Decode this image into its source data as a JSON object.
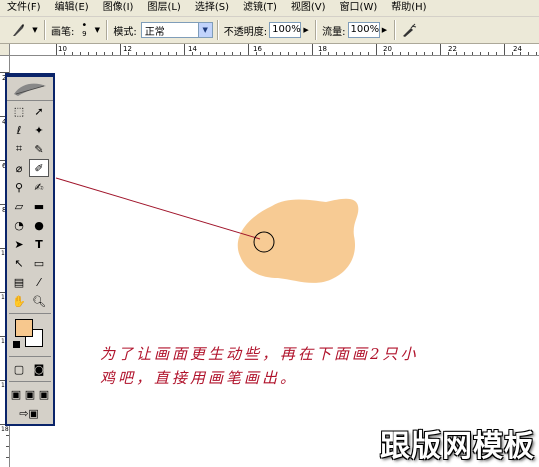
{
  "menu": [
    "文件(F)",
    "编辑(E)",
    "图像(I)",
    "图层(L)",
    "选择(S)",
    "滤镜(T)",
    "视图(V)",
    "窗口(W)",
    "帮助(H)"
  ],
  "options": {
    "brush_label": "画笔:",
    "brush_size": "9",
    "mode_label": "模式:",
    "mode_value": "正常",
    "opacity_label": "不透明度:",
    "opacity_value": "100%",
    "flow_label": "流量:",
    "flow_value": "100%"
  },
  "ruler": {
    "top": [
      "10",
      "12",
      "14",
      "16",
      "18",
      "20",
      "22",
      "24"
    ],
    "left": [
      "2",
      "4",
      "6",
      "8",
      "10",
      "12",
      "14",
      "16",
      "18"
    ]
  },
  "colors": {
    "foreground": "#f7c88e",
    "background": "#ffffff",
    "blob": "#f7c88e",
    "annotation": "#b0122b",
    "pointer_line": "#a0142a"
  },
  "annotation": {
    "line1": "为了让画面更生动些，再在下面画2只小",
    "line2": "鸡吧，直接用画笔画出。"
  },
  "watermark": "跟版网模板"
}
